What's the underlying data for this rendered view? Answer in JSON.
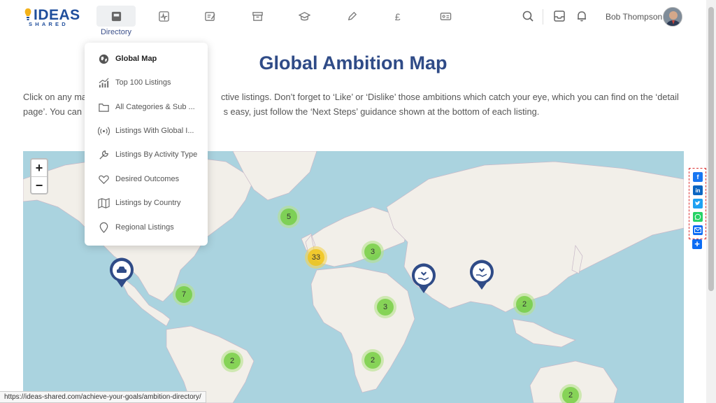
{
  "header": {
    "logo_main": "IDEAS",
    "logo_sub": "SHARED",
    "nav": [
      {
        "icon": "directory-icon",
        "active": true
      },
      {
        "icon": "activity-icon"
      },
      {
        "icon": "edit-note-icon"
      },
      {
        "icon": "archive-icon"
      },
      {
        "icon": "graduation-cap-icon"
      },
      {
        "icon": "pencil-icon"
      },
      {
        "icon": "pound-icon"
      },
      {
        "icon": "id-card-icon"
      }
    ],
    "active_caption": "Directory",
    "user_name": "Bob Thompson"
  },
  "page": {
    "title": "Global Ambition Map",
    "intro_line1": "Click on any ma               ctive listings. Don’t forget to ‘Like’ or ‘Dislike’ those ambitions which catch your eye, which you can find on the ‘detail",
    "intro_line2": "page’. You can g               s easy, just follow the ‘Next Steps’ guidance shown at the bottom of each listing."
  },
  "dropdown": {
    "items": [
      {
        "label": "Global Map",
        "icon": "globe-icon",
        "active": true
      },
      {
        "label": "Top 100 Listings",
        "icon": "chart-up-icon"
      },
      {
        "label": "All Categories & Sub ...",
        "icon": "folder-icon"
      },
      {
        "label": "Listings With Global I...",
        "icon": "broadcast-icon"
      },
      {
        "label": "Listings By Activity Type",
        "icon": "wrench-icon"
      },
      {
        "label": "Desired Outcomes",
        "icon": "heart-icon"
      },
      {
        "label": "Listings by Country",
        "icon": "map-icon"
      },
      {
        "label": "Regional Listings",
        "icon": "location-icon"
      }
    ]
  },
  "map": {
    "zoom_in": "+",
    "zoom_out": "−",
    "clusters": [
      "5",
      "33",
      "3",
      "7",
      "3",
      "2",
      "2",
      "2",
      "2"
    ]
  },
  "share": {
    "buttons": [
      "facebook-icon",
      "linkedin-icon",
      "twitter-icon",
      "whatsapp-icon",
      "email-icon"
    ],
    "more": "+"
  },
  "status_url": "https://ideas-shared.com/achieve-your-goals/ambition-directory/"
}
